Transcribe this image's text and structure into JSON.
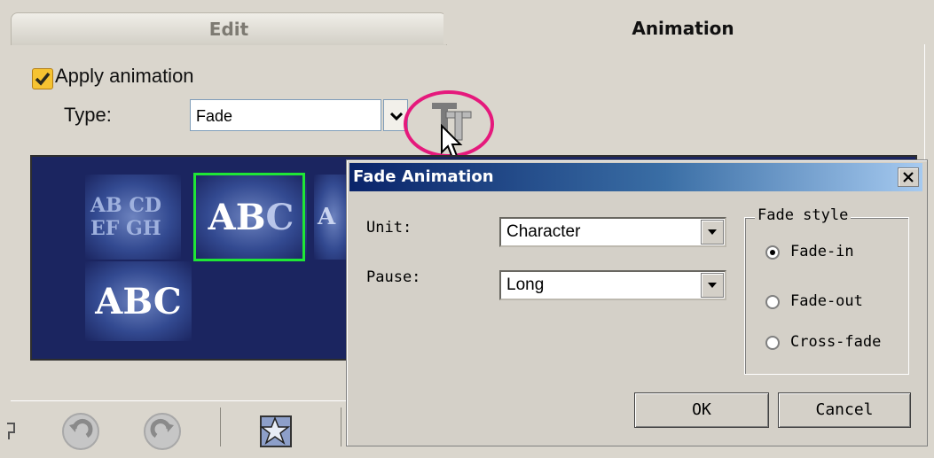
{
  "tabs": {
    "edit": "Edit",
    "animation": "Animation"
  },
  "apply": {
    "label": "Apply animation",
    "checked": true
  },
  "type": {
    "label": "Type:",
    "value": "Fade"
  },
  "preview": {
    "thumb1_line1": "AB CD",
    "thumb1_line2": "EF GH",
    "thumb2_a": "AB",
    "thumb2_b": "C",
    "thumb3": "A",
    "thumb4": "ABC"
  },
  "dialog": {
    "title": "Fade Animation",
    "unit_label": "Unit:",
    "unit_value": "Character",
    "pause_label": "Pause:",
    "pause_value": "Long",
    "fade_style": {
      "title": "Fade style",
      "options": [
        {
          "label": "Fade-in",
          "selected": true
        },
        {
          "label": "Fade-out",
          "selected": false
        },
        {
          "label": "Cross-fade",
          "selected": false
        }
      ]
    },
    "ok_label": "OK",
    "cancel_label": "Cancel"
  },
  "colors": {
    "highlight": "#e5197c",
    "selection": "#1fe636",
    "preview_bg": "#1b2560"
  }
}
